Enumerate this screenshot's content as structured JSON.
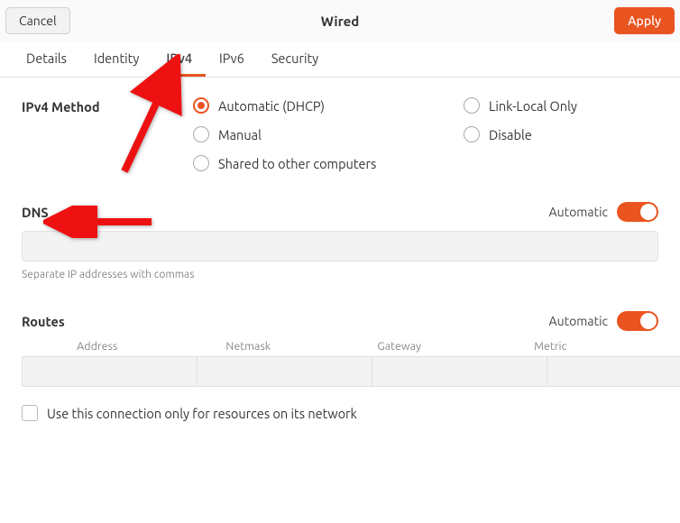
{
  "header": {
    "title": "Wired",
    "cancel_label": "Cancel",
    "apply_label": "Apply"
  },
  "tabs": {
    "details": "Details",
    "identity": "Identity",
    "ipv4": "IPv4",
    "ipv6": "IPv6",
    "security": "Security",
    "active": "ipv4"
  },
  "ipv4_method": {
    "title": "IPv4 Method",
    "options": {
      "auto": "Automatic (DHCP)",
      "link_local": "Link-Local Only",
      "manual": "Manual",
      "disable": "Disable",
      "shared": "Shared to other computers"
    },
    "selected": "auto"
  },
  "dns": {
    "title": "DNS",
    "automatic_label": "Automatic",
    "automatic_on": true,
    "value": "",
    "hint": "Separate IP addresses with commas"
  },
  "routes": {
    "title": "Routes",
    "automatic_label": "Automatic",
    "automatic_on": true,
    "columns": {
      "address": "Address",
      "netmask": "Netmask",
      "gateway": "Gateway",
      "metric": "Metric"
    },
    "row": {
      "address": "",
      "netmask": "",
      "gateway": "",
      "metric": ""
    }
  },
  "use_only_resources": {
    "label": "Use this connection only for resources on its network",
    "checked": false
  }
}
